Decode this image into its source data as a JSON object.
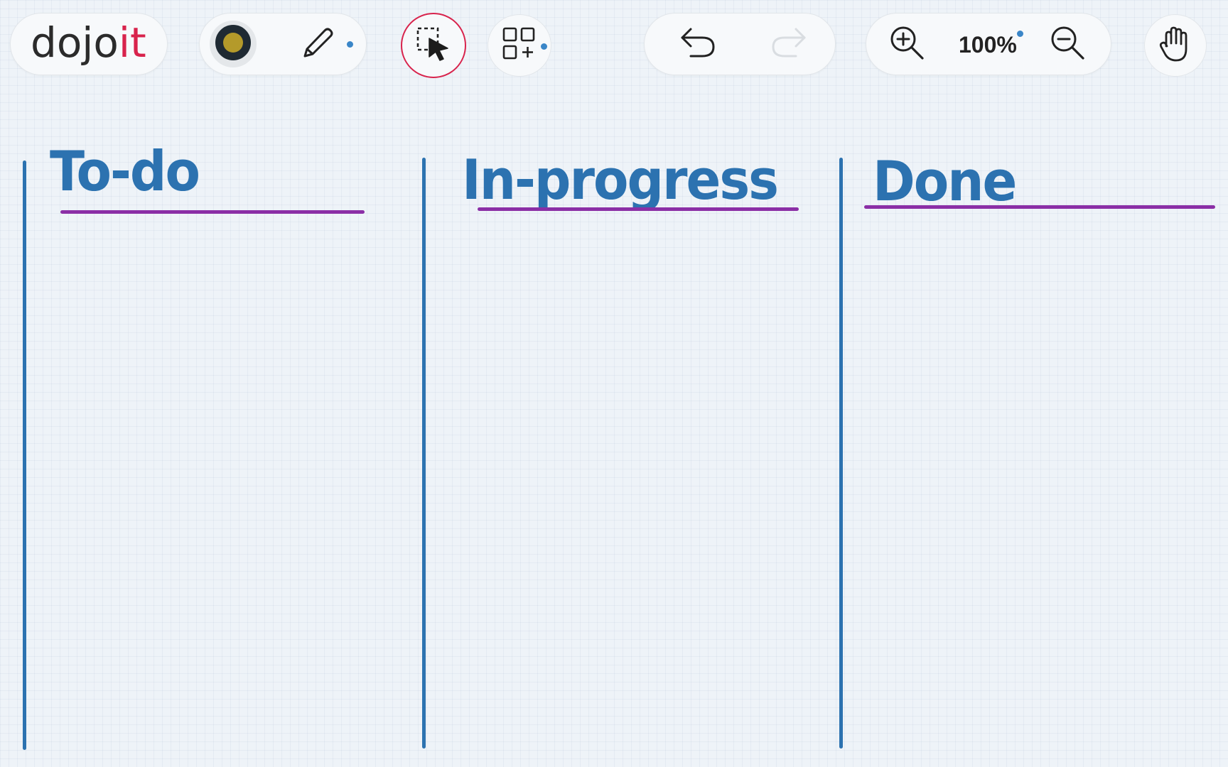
{
  "app": {
    "logo": {
      "part1": "dojo",
      "part2": "it"
    }
  },
  "toolbar": {
    "zoom_level": "100%",
    "icons": {
      "color_swatch": "color-swatch-icon",
      "pencil": "pencil-icon",
      "select": "select-cursor-icon",
      "components": "grid-add-icon",
      "undo": "undo-icon",
      "redo": "redo-icon",
      "zoom_in": "zoom-in-icon",
      "zoom_out": "zoom-out-icon",
      "hand": "hand-pan-icon"
    }
  },
  "board": {
    "columns": [
      {
        "title": "To-do"
      },
      {
        "title": "In-progress"
      },
      {
        "title": "Done"
      }
    ]
  },
  "colors": {
    "brand_dark": "#2b2b2b",
    "brand_accent": "#d8234c",
    "column_title": "#2c72b0",
    "column_divider": "#2c72b0",
    "title_underline": "#8b2fa6",
    "swatch_fill": "#b49a2a",
    "swatch_ring": "#1f2a33",
    "indicator_dot": "#3a86c8",
    "active_tool_ring": "#d8234c"
  }
}
